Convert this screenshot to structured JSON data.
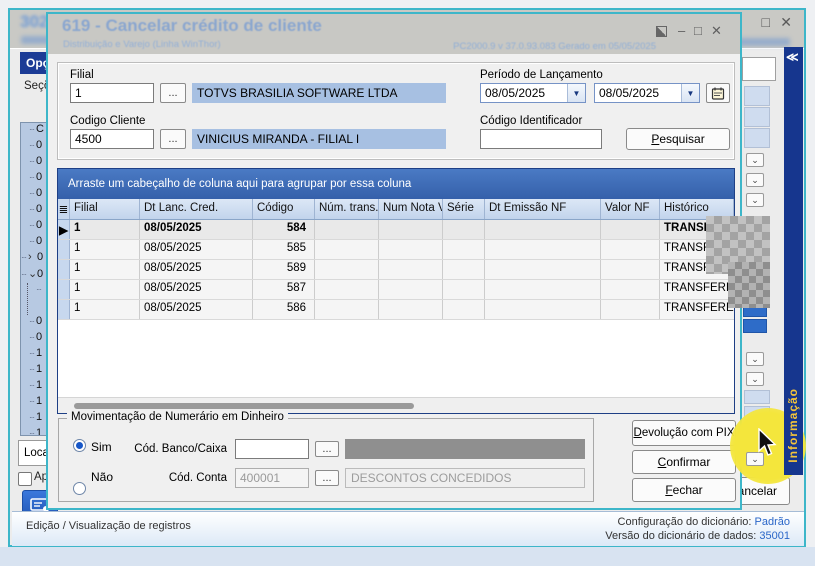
{
  "icons": {
    "collapse": "≪",
    "chevron_down": "⌄",
    "chevron_right": "›",
    "dropdown": "▼",
    "row_marker": "▶",
    "menu": "≣",
    "ellipsis": "...",
    "minimize": "–",
    "maximize": "□",
    "close": "✕"
  },
  "bg_window": {
    "title": "302",
    "sidebar": {
      "header": "Opções",
      "section": "Seções",
      "tree": [
        "C",
        "0",
        "0",
        "0",
        "0",
        "0",
        "0",
        "0",
        "0",
        "0",
        "0",
        "0",
        "1",
        "1",
        "1",
        "1",
        "1",
        "1",
        "1"
      ],
      "localizar": "Localizar",
      "checkbox_label": "Ap",
      "cancel_button": "Cancelar"
    },
    "status": {
      "left": "Edição / Visualização de registros",
      "dict_label": "Configuração do dicionário:",
      "dict_value": "Padrão",
      "ver_label": "Versão do dicionário de dados:",
      "ver_value": "35001"
    },
    "info_tab": "Informação"
  },
  "dialog": {
    "title": "619 - Cancelar crédito de cliente",
    "subtitle": "Distribuição e Varejo (Linha WinThor)",
    "version_text": "PC2000.9 v 37.0.93.083 Gerado em 05/05/2025",
    "form": {
      "filial_label": "Filial",
      "filial_code": "1",
      "filial_name": "TOTVS BRASILIA SOFTWARE LTDA",
      "periodo_label": "Período de Lançamento",
      "periodo_from": "08/05/2025",
      "periodo_to": "08/05/2025",
      "cliente_label": "Codigo Cliente",
      "cliente_code": "4500",
      "cliente_name": "VINICIUS MIRANDA - FILIAL I",
      "identificador_label": "Código Identificador",
      "identificador_value": "",
      "pesquisar": "Pesquisar"
    },
    "grid": {
      "group_hint": "Arraste um cabeçalho de coluna aqui para agrupar por essa coluna",
      "columns": [
        "Filial",
        "Dt Lanc. Cred.",
        "Código",
        "Núm. trans.",
        "Num Nota V",
        "Série",
        "Dt Emissão NF",
        "Valor NF",
        "Histórico"
      ],
      "rows": [
        {
          "filial": "1",
          "dt_lanc": "08/05/2025",
          "codigo": "584",
          "historico": "TRANSFERENCIA"
        },
        {
          "filial": "1",
          "dt_lanc": "08/05/2025",
          "codigo": "585",
          "historico": "TRANSFERENCIA"
        },
        {
          "filial": "1",
          "dt_lanc": "08/05/2025",
          "codigo": "589",
          "historico": "TRANSFERENCIA"
        },
        {
          "filial": "1",
          "dt_lanc": "08/05/2025",
          "codigo": "587",
          "historico": "TRANSFERENCIA"
        },
        {
          "filial": "1",
          "dt_lanc": "08/05/2025",
          "codigo": "586",
          "historico": "TRANSFERENCIA"
        }
      ]
    },
    "mov": {
      "legend": "Movimentação de Numerário em Dinheiro",
      "sim": "Sim",
      "nao": "Não",
      "banco_label": "Cód. Banco/Caixa",
      "banco_value": "",
      "conta_label": "Cód. Conta",
      "conta_value": "400001",
      "conta_desc": "DESCONTOS CONCEDIDOS"
    },
    "buttons": {
      "pix": "Devolução com PIX",
      "confirmar": "Confirmar",
      "fechar": "Fechar"
    }
  }
}
